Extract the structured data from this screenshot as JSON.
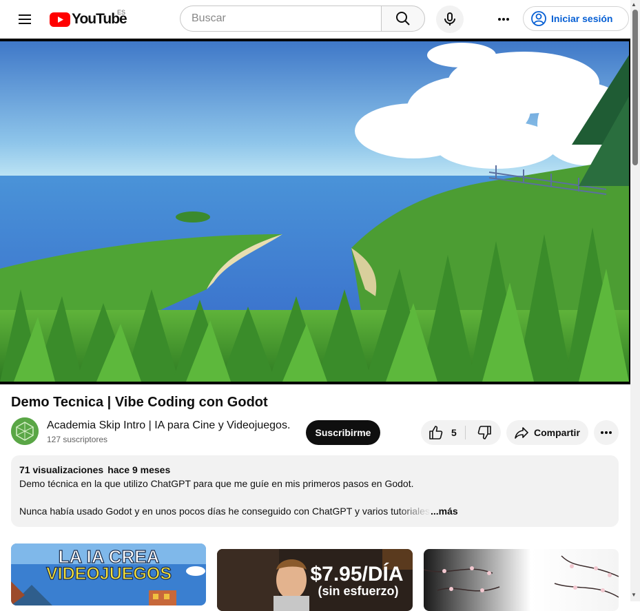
{
  "header": {
    "logo_text": "YouTube",
    "region": "ES",
    "search_placeholder": "Buscar",
    "signin_label": "Iniciar sesión"
  },
  "video": {
    "title": "Demo Tecnica | Vibe Coding con Godot"
  },
  "channel": {
    "name": "Academia Skip Intro | IA para Cine y Videojuegos.",
    "subscribers": "127 suscriptores",
    "subscribe_label": "Suscribirme"
  },
  "actions": {
    "like_count": "5",
    "share_label": "Compartir"
  },
  "description": {
    "views": "71 visualizaciones",
    "date": "hace 9 meses",
    "line1": "Demo técnica en la que utilizo ChatGPT para que me guíe en mis primeros pasos en Godot.",
    "line2": "Nunca había usado Godot y en unos pocos días he conseguido con ChatGPT y varios tutoriales ...",
    "more_label": "...más"
  },
  "recommendations": [
    {
      "thumb_line1": "LA IA CREA",
      "thumb_line2": "VIDEOJUEGOS"
    },
    {
      "thumb_line1": "$7.95/DÍA",
      "thumb_line2": "(sin esfuerzo)"
    },
    {}
  ],
  "colors": {
    "brand_red": "#ff0000",
    "link_blue": "#065fd4",
    "subscribe_bg": "#0f0f0f",
    "chip_bg": "#f2f2f2"
  },
  "icons": [
    "menu-icon",
    "youtube-logo-icon",
    "search-icon",
    "mic-icon",
    "more-vert-icon",
    "account-circle-icon",
    "like-icon",
    "dislike-icon",
    "share-icon",
    "more-horiz-icon"
  ]
}
